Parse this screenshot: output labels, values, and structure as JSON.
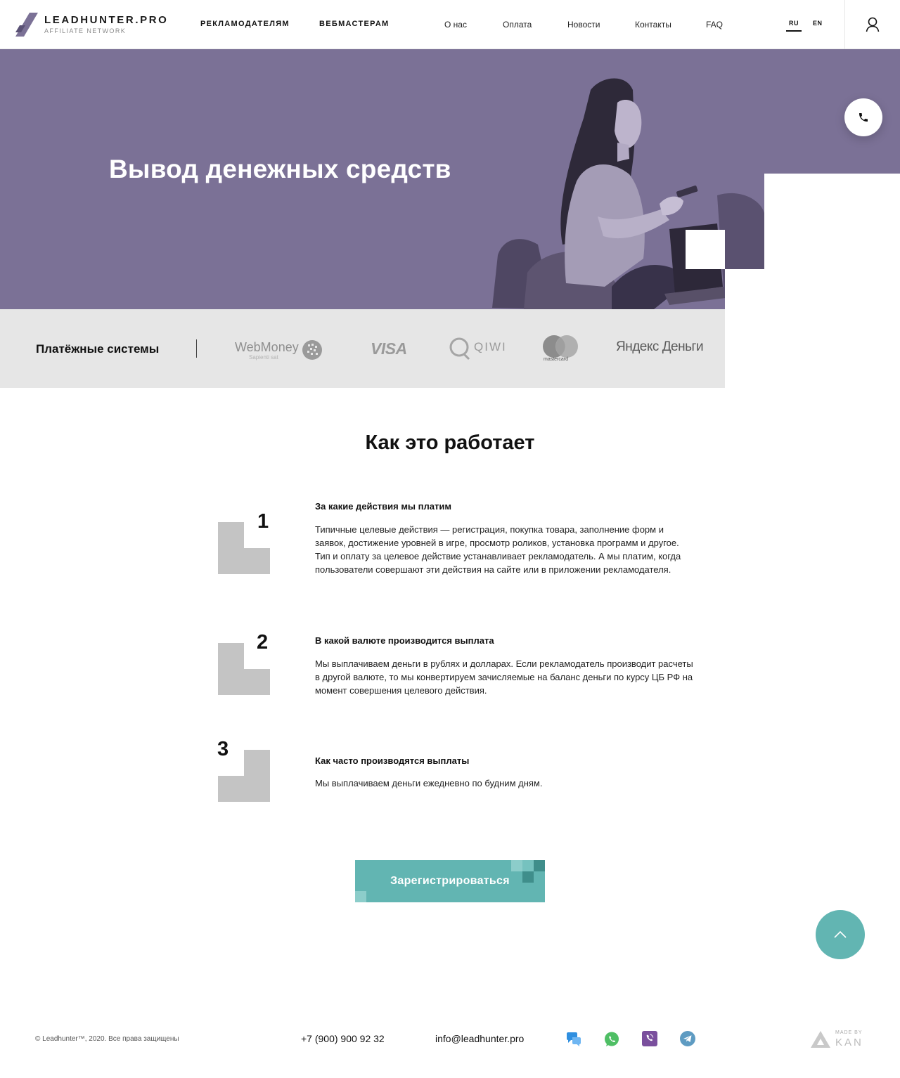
{
  "header": {
    "logo_name": "LEADHUNTER.PRO",
    "logo_sub": "AFFILIATE NETWORK",
    "nav_main": [
      "РЕКЛАМОДАТЕЛЯМ",
      "ВЕБМАСТЕРАМ"
    ],
    "nav_secondary": [
      "О нас",
      "Оплата",
      "Новости",
      "Контакты",
      "FAQ"
    ],
    "lang_ru": "RU",
    "lang_en": "EN"
  },
  "hero": {
    "title": "Вывод денежных средств"
  },
  "payments": {
    "title": "Платёжные системы",
    "webmoney": "WebMoney",
    "webmoney_sub": "Sapienti sat",
    "visa": "VISA",
    "qiwi": "QIWI",
    "mastercard": "mastercard",
    "yandex_a": "Яндекс",
    "yandex_b": "Деньги"
  },
  "how": {
    "title": "Как это работает",
    "steps": [
      {
        "num": "1",
        "title": "За какие действия мы платим",
        "text": "Типичные целевые действия — регистрация, покупка товара, заполнение форм и заявок, достижение уровней в игре, просмотр роликов, установка программ и другое. Тип и оплату за целевое действие устанавливает рекламодатель. А мы платим, когда пользователи совершают эти действия на сайте или в приложении рекламодателя."
      },
      {
        "num": "2",
        "title": "В какой валюте производится выплата",
        "text": "Мы выплачиваем деньги в рублях и долларах. Если рекламодатель производит расчеты в другой валюте, то мы конвертируем зачисляемые на баланс деньги по курсу ЦБ РФ на момент совершения целевого действия."
      },
      {
        "num": "3",
        "title": "Как часто производятся выплаты",
        "text": "Мы выплачиваем деньги ежедневно по будним дням."
      }
    ]
  },
  "cta": {
    "label": "Зарегистрироваться"
  },
  "footer": {
    "copyright": "© Leadhunter™, 2020. Все права защищены",
    "phone": "+7 (900) 900 92 32",
    "email": "info@leadhunter.pro",
    "madeby_small": "MADE BY",
    "madeby_big": "KAN"
  },
  "colors": {
    "hero_bg": "#7b7196",
    "accent_teal": "#62b5b2",
    "paybar_bg": "#e6e6e6",
    "step_shape": "#c4c4c4"
  },
  "icons": [
    "logo-mark-icon",
    "user-icon",
    "phone-icon",
    "chevron-up-icon",
    "chat-icon",
    "whatsapp-icon",
    "viber-icon",
    "telegram-icon",
    "kan-logo-icon"
  ]
}
